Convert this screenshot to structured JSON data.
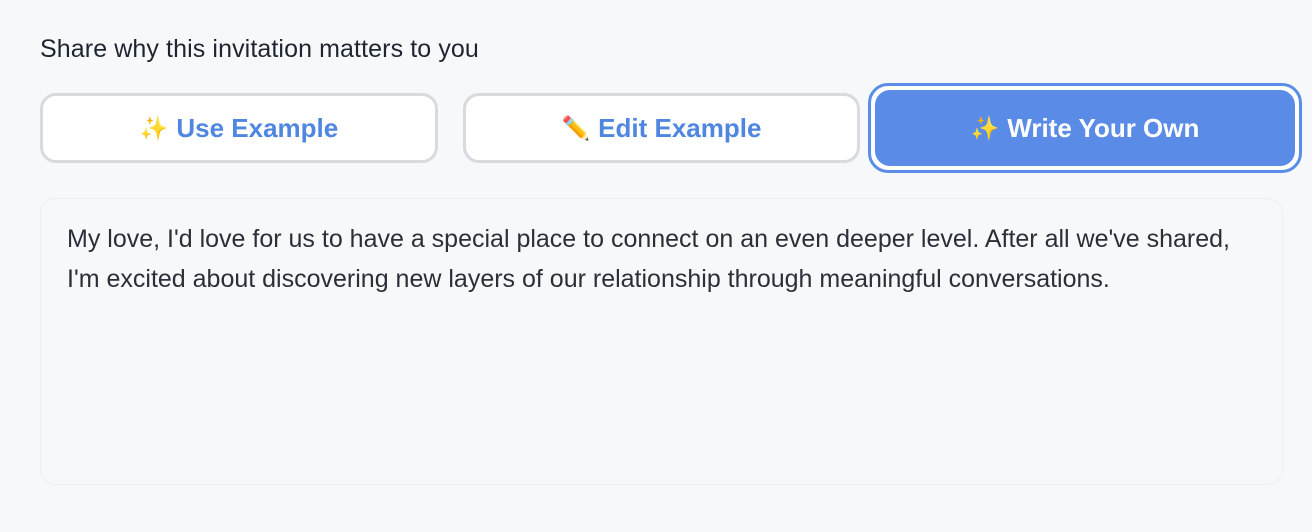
{
  "form": {
    "section_label": "Share why this invitation matters to you",
    "options": [
      {
        "emoji": "✨",
        "icon": "sparkles-icon",
        "label": "Use Example"
      },
      {
        "emoji": "✏️",
        "icon": "pencil-icon",
        "label": "Edit Example"
      },
      {
        "emoji": "✨",
        "icon": "sparkles-icon",
        "label": "Write Your Own",
        "selected": true
      }
    ],
    "message_value": "My love, I'd love for us to have a special place to connect on an even deeper level. After all we've shared, I'm excited about discovering new layers of our relationship through meaningful conversations."
  },
  "colors": {
    "accent": "#5a8be7",
    "button_text": "#4f86e0",
    "border": "#d7dade",
    "background": "#f7f8fa"
  }
}
